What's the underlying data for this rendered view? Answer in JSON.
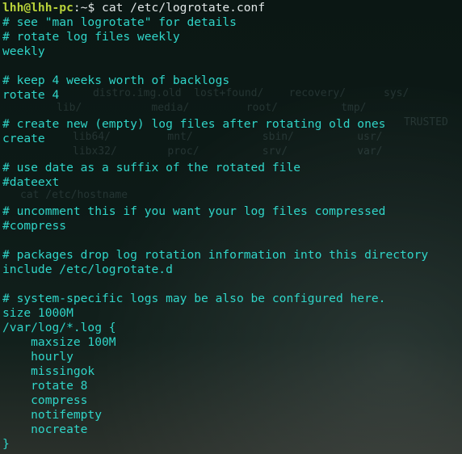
{
  "terminal": {
    "prompt_user_host": "lhh@lhh-pc",
    "prompt_path": ":~$ ",
    "command": "cat /etc/logrotate.conf",
    "lines": [
      "# see \"man logrotate\" for details",
      "# rotate log files weekly",
      "weekly",
      "",
      "# keep 4 weeks worth of backlogs",
      "rotate 4",
      "",
      "# create new (empty) log files after rotating old ones",
      "create",
      "",
      "# use date as a suffix of the rotated file",
      "#dateext",
      "",
      "# uncomment this if you want your log files compressed",
      "#compress",
      "",
      "# packages drop log rotation information into this directory",
      "include /etc/logrotate.d",
      "",
      "# system-specific logs may be also be configured here.",
      "size 1000M",
      "/var/log/*.log {",
      "    maxsize 100M",
      "    hourly",
      "    missingok",
      "    rotate 8",
      "    compress",
      "    notifempty",
      "    nocreate",
      "}"
    ]
  }
}
